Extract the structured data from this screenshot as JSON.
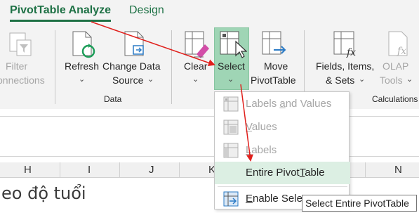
{
  "tabs": {
    "pivot_analyze": "PivotTable Analyze",
    "design": "Design"
  },
  "ribbon": {
    "filter_connections": [
      "Filter",
      "onnections"
    ],
    "refresh": "Refresh",
    "change_data_source": [
      "Change Data",
      "Source"
    ],
    "data_group": "Data",
    "clear": "Clear",
    "select": "Select",
    "move_pivot": [
      "Move",
      "PivotTable"
    ],
    "fields_items_sets": [
      "Fields, Items,",
      "& Sets"
    ],
    "olap_tools": [
      "OLAP",
      "Tools"
    ],
    "calculations_group": "Calculations"
  },
  "sheet": {
    "columns": [
      "H",
      "I",
      "J",
      "K",
      "N"
    ],
    "cell_text": "eo độ tuổi"
  },
  "menu": {
    "items": [
      {
        "pre": "Labels ",
        "u": "a",
        "post": "nd Values"
      },
      {
        "pre": "",
        "u": "V",
        "post": "alues"
      },
      {
        "pre": "",
        "u": "L",
        "post": "abels"
      },
      {
        "pre": "Entire Pivot",
        "u": "T",
        "post": "able"
      },
      {
        "pre": "",
        "u": "E",
        "post": "nable Selec"
      }
    ]
  },
  "tooltip": "Select Entire PivotTable",
  "colors": {
    "accent": "#1e7145",
    "select_bg": "#9fd5b5",
    "arrow": "#e0201c"
  }
}
